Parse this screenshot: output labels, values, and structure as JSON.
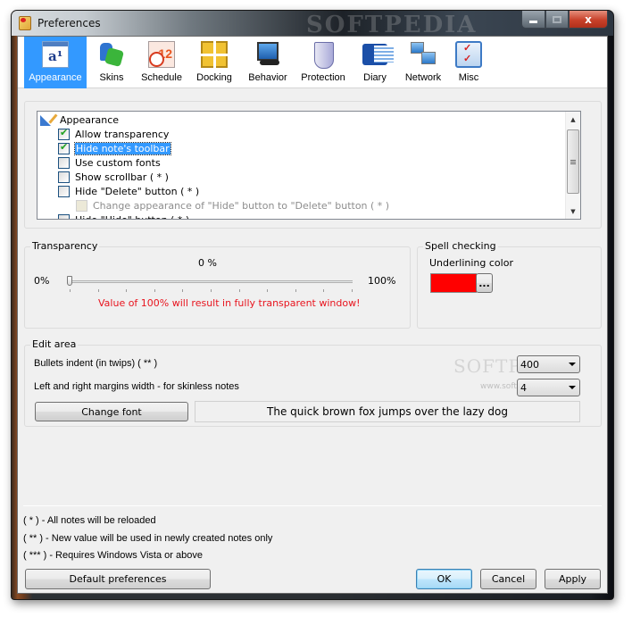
{
  "window": {
    "title": "Preferences",
    "watermark": "SOFTPEDIA",
    "controls": {
      "minimize": "minimize",
      "maximize": "maximize",
      "close": "x"
    }
  },
  "toolbar": {
    "tabs": [
      {
        "label": "Appearance",
        "icon": "appearance-icon",
        "active": true
      },
      {
        "label": "Skins",
        "icon": "puzzle-icon",
        "active": false
      },
      {
        "label": "Schedule",
        "icon": "calendar-clock-icon",
        "active": false
      },
      {
        "label": "Docking",
        "icon": "docking-grid-icon",
        "active": false
      },
      {
        "label": "Behavior",
        "icon": "computer-icon",
        "active": false
      },
      {
        "label": "Protection",
        "icon": "shield-icon",
        "active": false
      },
      {
        "label": "Diary",
        "icon": "book-icon",
        "active": false
      },
      {
        "label": "Network",
        "icon": "network-icon",
        "active": false
      },
      {
        "label": "Misc",
        "icon": "checklist-icon",
        "active": false
      }
    ]
  },
  "options_tree": {
    "root": "Appearance",
    "items": [
      {
        "label": "Allow transparency",
        "checked": true,
        "selected": false,
        "disabled": false,
        "level": 1
      },
      {
        "label": "Hide note's toolbar",
        "checked": true,
        "selected": true,
        "disabled": false,
        "level": 1
      },
      {
        "label": "Use custom fonts",
        "checked": false,
        "selected": false,
        "disabled": false,
        "level": 1
      },
      {
        "label": "Show scrollbar ( * )",
        "checked": false,
        "selected": false,
        "disabled": false,
        "level": 1
      },
      {
        "label": "Hide \"Delete\" button ( * )",
        "checked": false,
        "selected": false,
        "disabled": false,
        "level": 1
      },
      {
        "label": "Change appearance of \"Hide\" button to \"Delete\" button ( * )",
        "checked": false,
        "selected": false,
        "disabled": true,
        "level": 2
      },
      {
        "label": "Hide \"Hide\" button ( * )",
        "checked": false,
        "selected": false,
        "disabled": false,
        "level": 1
      }
    ]
  },
  "transparency": {
    "legend": "Transparency",
    "current_label": "0 %",
    "value_percent": 0,
    "min_label": "0%",
    "max_label": "100%",
    "warning": "Value of 100% will result in fully transparent window!",
    "warning_color": "#e8141e"
  },
  "spell_checking": {
    "legend": "Spell checking",
    "underline_label": "Underlining color",
    "underline_color": "#ff0000",
    "picker_button": "..."
  },
  "edit_area": {
    "legend": "Edit area",
    "bullets_label": "Bullets indent (in twips) ( ** )",
    "bullets_value": "400",
    "margins_label": "Left and right margins width - for skinless notes",
    "margins_value": "4",
    "change_font_button": "Change font",
    "font_preview": "The quick brown fox jumps over the lazy dog",
    "watermark": "SOFTPEDIA",
    "watermark_url": "www.softpedia.com"
  },
  "notes": [
    "( * ) - All notes will be reloaded",
    "( ** ) - New value will be used in newly created notes only",
    "( *** ) - Requires Windows Vista or above"
  ],
  "buttons": {
    "default_prefs": "Default preferences",
    "ok": "OK",
    "cancel": "Cancel",
    "apply": "Apply"
  }
}
